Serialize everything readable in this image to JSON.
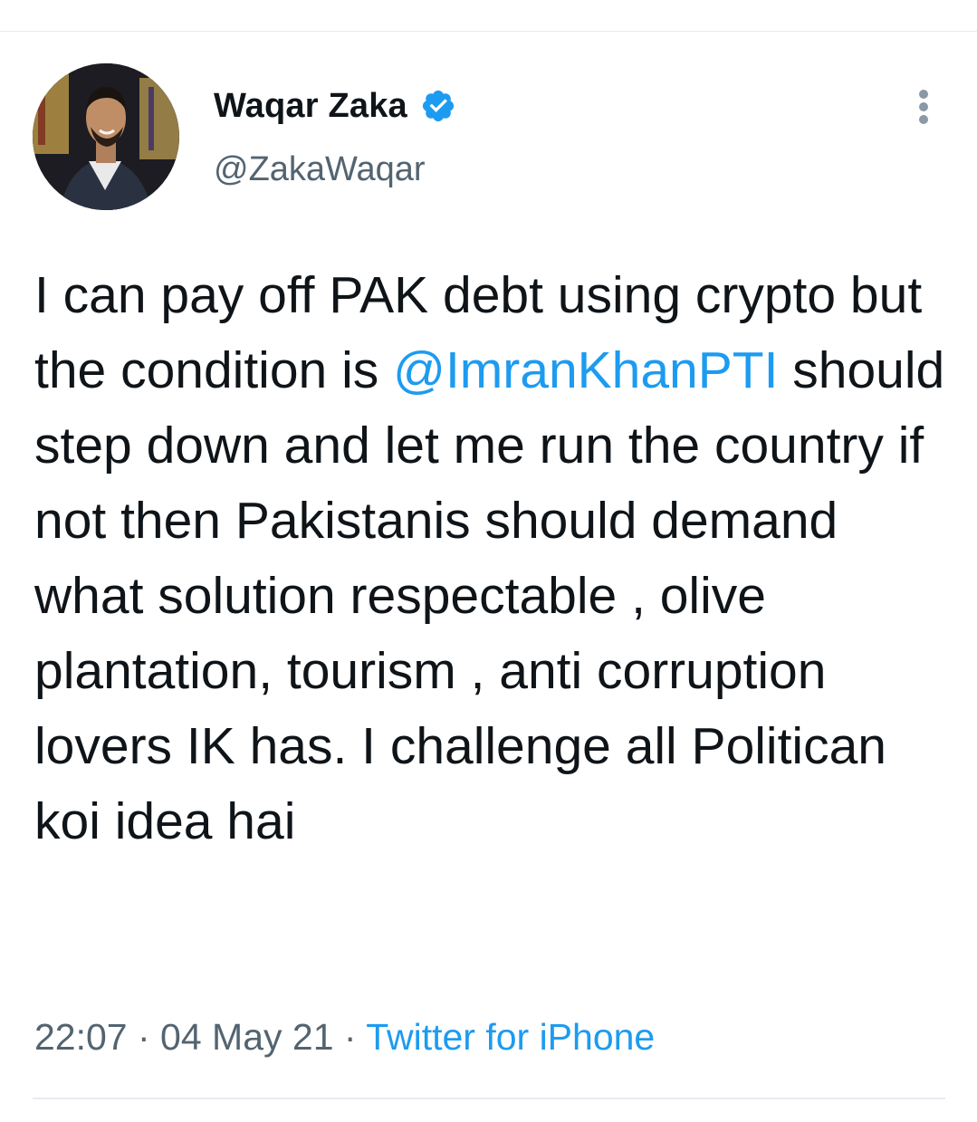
{
  "author": {
    "display_name": "Waqar Zaka",
    "handle": "@ZakaWaqar",
    "verified": true
  },
  "tweet": {
    "text_before_mention": "I can pay off PAK debt using crypto but the condition is ",
    "mention": "@ImranKhanPTI",
    "text_after_mention": " should step down and let me run the country if not then Pakistanis should demand what solution respectable , olive plantation, tourism , anti corruption lovers IK has. I challenge all Politican koi idea hai"
  },
  "meta": {
    "time": "22:07",
    "separator_1": " · ",
    "date": "04 May 21",
    "separator_2": " · ",
    "source": "Twitter for iPhone"
  },
  "icons": {
    "verified": "verified-badge-icon",
    "more": "more-vertical-icon"
  },
  "colors": {
    "link": "#1d9bf0",
    "secondary_text": "#536471",
    "primary_text": "#0f1419",
    "divider": "#e6ecf0"
  }
}
